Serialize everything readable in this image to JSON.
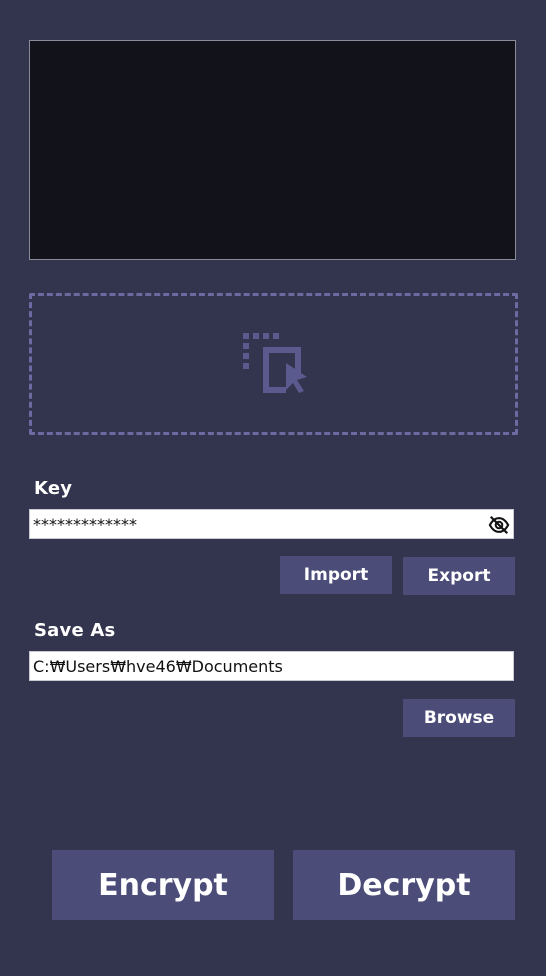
{
  "key": {
    "label": "Key",
    "value": "*************",
    "visibility_icon": "eye-off-icon"
  },
  "actions": {
    "import_label": "Import",
    "export_label": "Export",
    "browse_label": "Browse",
    "encrypt_label": "Encrypt",
    "decrypt_label": "Decrypt"
  },
  "save_as": {
    "label": "Save As",
    "value": "C:₩Users₩hve46₩Documents"
  },
  "dropzone": {
    "icon": "select-cursor-icon"
  },
  "colors": {
    "background": "#33344d",
    "button": "#4b4c78",
    "preview": "#12121b",
    "dropzone_border": "#6b6ba1"
  }
}
